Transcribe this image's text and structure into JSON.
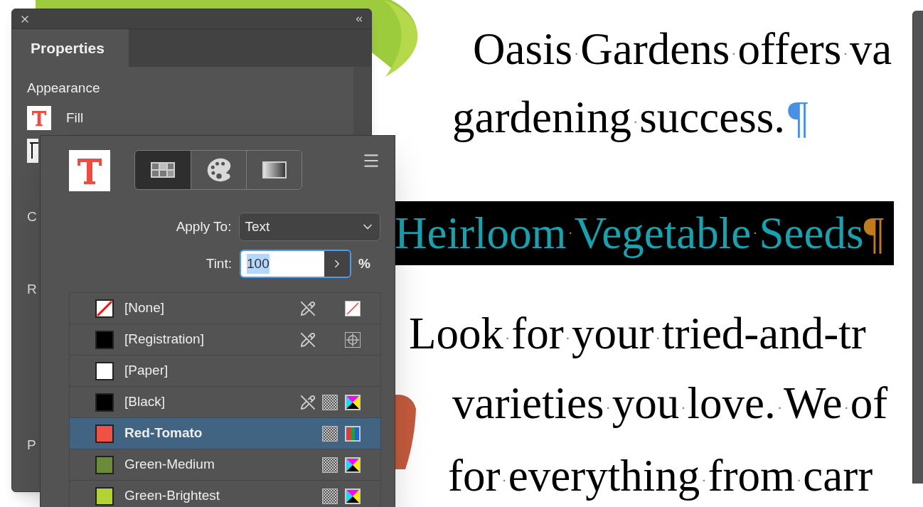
{
  "document": {
    "space_mark": "·",
    "paragraph_mark": "¶",
    "lines": [
      {
        "kind": "body",
        "words": [
          "Oasis",
          "Gardens",
          "offers",
          "va"
        ],
        "paragraph_end": false
      },
      {
        "kind": "body",
        "words": [
          "gardening",
          "success."
        ],
        "paragraph_end": true
      },
      {
        "kind": "heading",
        "words": [
          "Heirloom",
          "Vegetable",
          "Seeds"
        ],
        "paragraph_end": true,
        "highlighted": true
      },
      {
        "kind": "body",
        "words": [
          "Look",
          "for",
          "your",
          "tried-and-tr"
        ],
        "paragraph_end": false
      },
      {
        "kind": "body",
        "words": [
          "varieties",
          "you",
          "love.",
          "We",
          "of"
        ],
        "paragraph_end": false
      },
      {
        "kind": "body",
        "words": [
          "for",
          "everything",
          "from",
          "carr"
        ],
        "paragraph_end": false
      }
    ]
  },
  "properties_panel": {
    "tabs": [
      {
        "label": "Properties",
        "selected": true
      }
    ],
    "section_title": "Appearance",
    "fill_label": "Fill",
    "partial_labels": [
      "C",
      "R",
      "P"
    ]
  },
  "swatches_panel": {
    "view_tabs": [
      {
        "kind": "swatches",
        "selected": true
      },
      {
        "kind": "color",
        "selected": false
      },
      {
        "kind": "gradient",
        "selected": false
      }
    ],
    "apply_to": {
      "label": "Apply To:",
      "value": "Text"
    },
    "tint": {
      "label": "Tint:",
      "value": "100",
      "unit": "%",
      "text_selected": true
    },
    "swatches": [
      {
        "name": "[None]",
        "kind": "none",
        "color": "#ffffff",
        "locked": true,
        "process": false,
        "mode_icon": {
          "kind": "none"
        },
        "selected": false
      },
      {
        "name": "[Registration]",
        "kind": "solid",
        "color": "#000000",
        "locked": true,
        "process": false,
        "mode_icon": {
          "kind": "registration"
        },
        "selected": false
      },
      {
        "name": "[Paper]",
        "kind": "solid",
        "color": "#ffffff",
        "locked": false,
        "process": false,
        "selected": false
      },
      {
        "name": "[Black]",
        "kind": "solid",
        "color": "#000000",
        "locked": true,
        "process": true,
        "mode_icon": {
          "kind": "cmyk"
        },
        "selected": false
      },
      {
        "name": "Red-Tomato",
        "kind": "solid",
        "color": "#f15145",
        "locked": false,
        "process": true,
        "mode_icon": {
          "kind": "rgb"
        },
        "selected": true
      },
      {
        "name": "Green-Medium",
        "kind": "solid",
        "color": "#6a8c3a",
        "locked": false,
        "process": true,
        "mode_icon": {
          "kind": "cmyk"
        },
        "selected": false
      },
      {
        "name": "Green-Brightest",
        "kind": "solid",
        "color": "#b3d334",
        "locked": false,
        "process": true,
        "mode_icon": {
          "kind": "cmyk"
        },
        "selected": false
      }
    ]
  }
}
